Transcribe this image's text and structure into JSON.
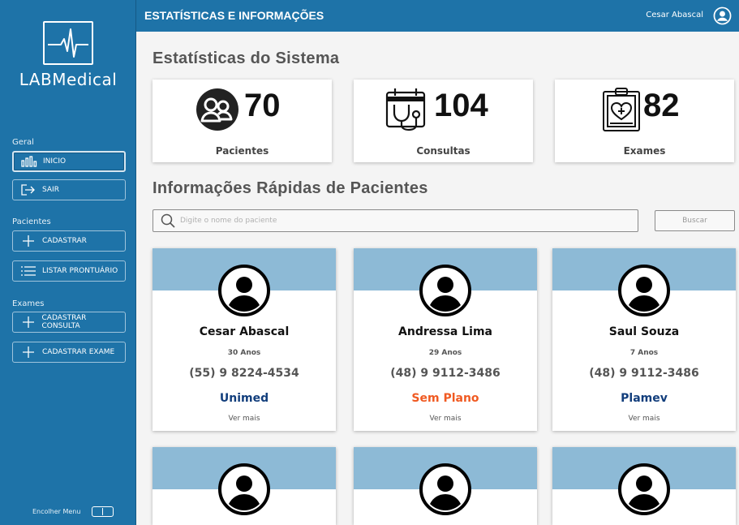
{
  "app": {
    "logo_text": "LABMedical"
  },
  "header": {
    "title": "ESTATÍSTICAS E INFORMAÇÕES",
    "user_name": "Cesar Abascal"
  },
  "sidebar": {
    "groups": [
      {
        "label": "Geral",
        "items": [
          {
            "label": "INICIO",
            "icon": "bar-chart-icon",
            "active": true
          },
          {
            "label": "SAIR",
            "icon": "logout-icon"
          }
        ]
      },
      {
        "label": "Pacientes",
        "items": [
          {
            "label": "CADASTRAR",
            "icon": "plus-icon"
          },
          {
            "label": "LISTAR PRONTUÁRIO",
            "icon": "list-icon"
          }
        ]
      },
      {
        "label": "Exames",
        "items": [
          {
            "label": "CADASTRAR CONSULTA",
            "icon": "plus-icon"
          },
          {
            "label": "CADASTRAR EXAME",
            "icon": "plus-icon"
          }
        ]
      }
    ],
    "collapse_label": "Encolher Menu"
  },
  "stats": {
    "title": "Estatísticas do Sistema",
    "cards": [
      {
        "value": "70",
        "label": "Pacientes",
        "icon": "patients-icon"
      },
      {
        "value": "104",
        "label": "Consultas",
        "icon": "calendar-stethoscope-icon"
      },
      {
        "value": "82",
        "label": "Exames",
        "icon": "clipboard-heart-icon"
      }
    ]
  },
  "patients": {
    "title": "Informações Rápidas de Pacientes",
    "search_placeholder": "Digite o nome do paciente",
    "search_button": "Buscar",
    "cards": [
      {
        "name": "Cesar Abascal",
        "age": "30 Anos",
        "phone": "(55) 9 8224-4534",
        "plan": "Unimed",
        "plan_color": "#123e7c",
        "more": "Ver mais"
      },
      {
        "name": "Andressa Lima",
        "age": "29 Anos",
        "phone": "(48) 9 9112-3486",
        "plan": "Sem Plano",
        "plan_color": "#f05a22",
        "more": "Ver mais"
      },
      {
        "name": "Saul Souza",
        "age": "7 Anos",
        "phone": "(48) 9 9112-3486",
        "plan": "Plamev",
        "plan_color": "#123e7c",
        "more": "Ver mais"
      }
    ]
  },
  "colors": {
    "primary": "#1e73a8",
    "card_band": "#8dbad6",
    "background": "#f4f4f4"
  }
}
